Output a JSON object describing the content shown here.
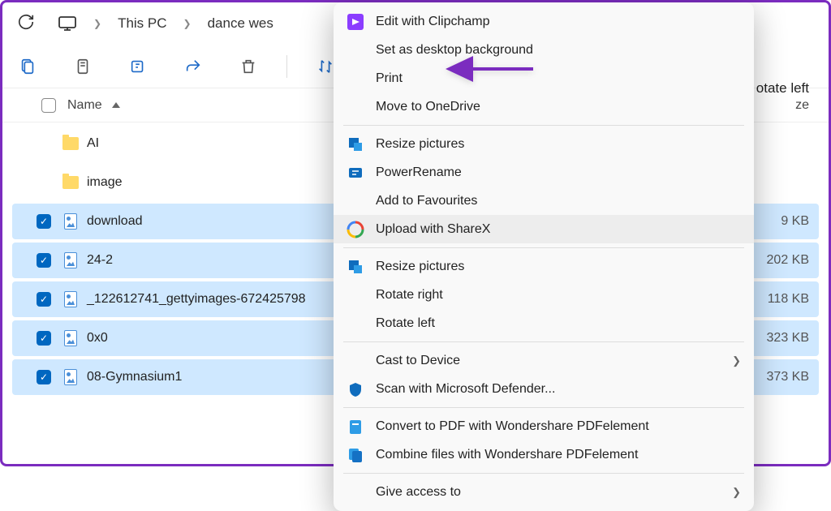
{
  "colors": {
    "accent": "#7b2cbf",
    "selected": "#cfe8ff",
    "folder": "#ffd968"
  },
  "breadcrumb": {
    "l1": "This PC",
    "l2": "dance wes"
  },
  "toolbar_right": "otate left",
  "header": {
    "name_col": "Name",
    "size_col": "ze"
  },
  "files": [
    {
      "name": "AI",
      "type": "folder",
      "selected": false,
      "size": ""
    },
    {
      "name": "image",
      "type": "folder",
      "selected": false,
      "size": ""
    },
    {
      "name": "download",
      "type": "image",
      "selected": true,
      "size": "9 KB"
    },
    {
      "name": "24-2",
      "type": "image",
      "selected": true,
      "size": "202 KB"
    },
    {
      "name": "_122612741_gettyimages-672425798",
      "type": "image",
      "selected": true,
      "size": "118 KB"
    },
    {
      "name": "0x0",
      "type": "image",
      "selected": true,
      "size": "323 KB"
    },
    {
      "name": "08-Gymnasium1",
      "type": "image",
      "selected": true,
      "size": "373 KB"
    }
  ],
  "menu": [
    {
      "label": "Edit with Clipchamp",
      "icon": "clipchamp"
    },
    {
      "label": "Set as desktop background",
      "icon": ""
    },
    {
      "label": "Print",
      "icon": ""
    },
    {
      "label": "Move to OneDrive",
      "icon": ""
    },
    {
      "sep": true
    },
    {
      "label": "Resize pictures",
      "icon": "resize"
    },
    {
      "label": "PowerRename",
      "icon": "rename"
    },
    {
      "label": "Add to Favourites",
      "icon": ""
    },
    {
      "label": "Upload with ShareX",
      "icon": "sharex",
      "hover": true
    },
    {
      "sep": true
    },
    {
      "label": "Resize pictures",
      "icon": "resize"
    },
    {
      "label": "Rotate right",
      "icon": ""
    },
    {
      "label": "Rotate left",
      "icon": ""
    },
    {
      "sep": true
    },
    {
      "label": "Cast to Device",
      "icon": "",
      "sub": true
    },
    {
      "label": "Scan with Microsoft Defender...",
      "icon": "shield"
    },
    {
      "sep": true
    },
    {
      "label": "Convert to PDF with Wondershare PDFelement",
      "icon": "pdf"
    },
    {
      "label": "Combine files with Wondershare PDFelement",
      "icon": "pdfc"
    },
    {
      "sep": true
    },
    {
      "label": "Give access to",
      "icon": "",
      "sub": true
    }
  ]
}
